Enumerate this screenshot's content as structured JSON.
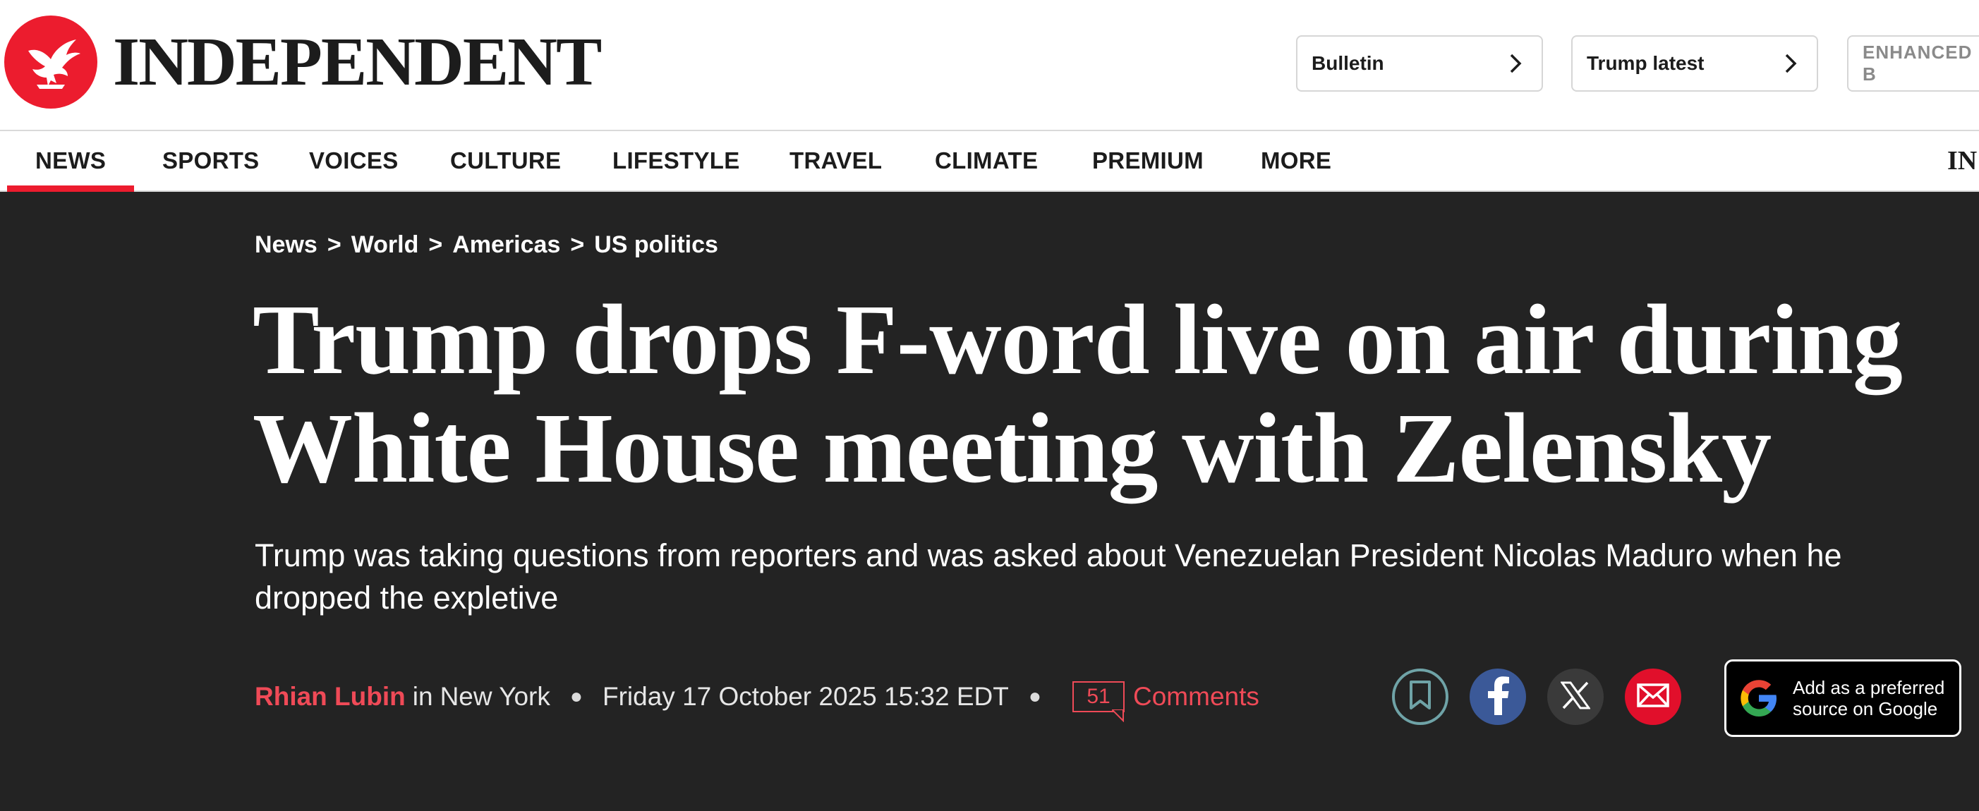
{
  "masthead": {
    "logo_text": "INDEPENDENT",
    "pills": [
      {
        "label": "Bulletin"
      },
      {
        "label": "Trump latest"
      },
      {
        "label": "ENHANCED B"
      }
    ]
  },
  "nav": {
    "items": [
      {
        "label": "NEWS",
        "active": true
      },
      {
        "label": "SPORTS"
      },
      {
        "label": "VOICES"
      },
      {
        "label": "CULTURE"
      },
      {
        "label": "LIFESTYLE"
      },
      {
        "label": "TRAVEL"
      },
      {
        "label": "CLIMATE"
      },
      {
        "label": "PREMIUM"
      },
      {
        "label": "MORE"
      }
    ],
    "right_logo_text": "IN"
  },
  "article": {
    "breadcrumb": [
      "News",
      "World",
      "Americas",
      "US politics"
    ],
    "breadcrumb_separator": ">",
    "headline_line1": "Trump drops F-word live on air during",
    "headline_line2": "White House meeting with Zelensky",
    "standfirst": "Trump was taking questions from reporters and was asked about Venezuelan President Nicolas Maduro when he dropped the expletive",
    "author": "Rhian Lubin",
    "location_prefix": "in",
    "location": "New York",
    "date": "Friday 17 October 2025 15:32 EDT",
    "comment_count": "51",
    "comments_label": "Comments"
  },
  "share": {
    "icons": [
      "bookmark-icon",
      "facebook-icon",
      "x-icon",
      "email-icon"
    ]
  },
  "google_pref": {
    "line1": "Add as a preferred",
    "line2": "source on Google"
  },
  "colors": {
    "brand_red": "#ec1c2e",
    "dark_bg": "#232323",
    "link_red": "#ef4a57"
  }
}
